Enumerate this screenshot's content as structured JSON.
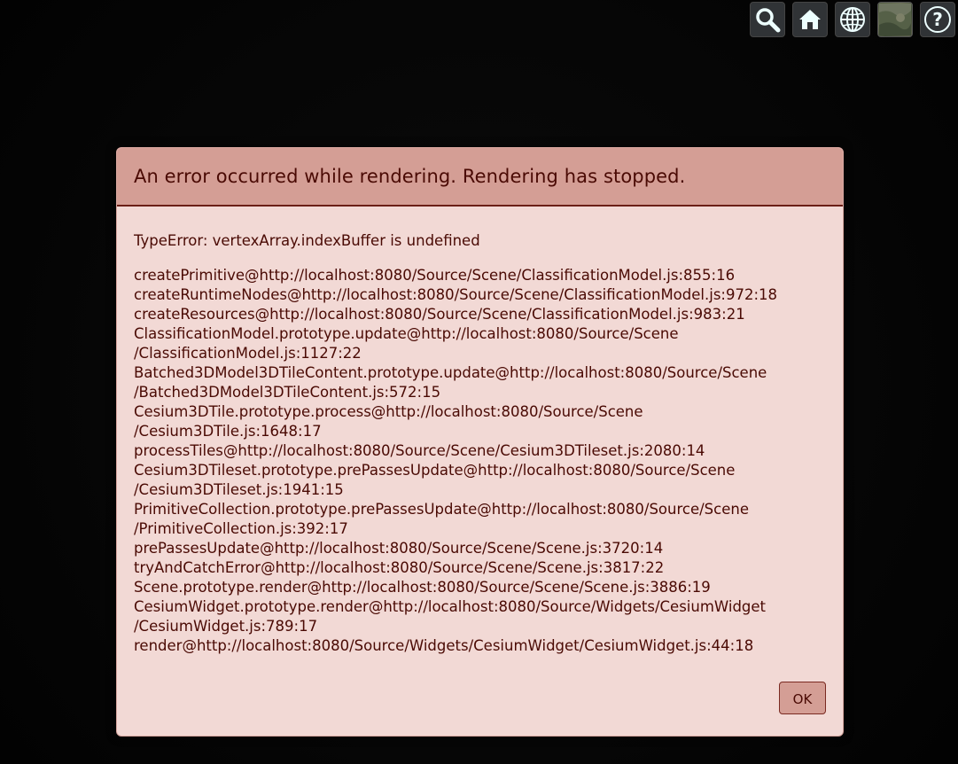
{
  "toolbar": {
    "buttons": [
      {
        "name": "search-icon"
      },
      {
        "name": "home-icon"
      },
      {
        "name": "globe-icon"
      },
      {
        "name": "imagery-layer-icon"
      },
      {
        "name": "help-icon",
        "glyph": "?"
      }
    ]
  },
  "error_dialog": {
    "title": "An error occurred while rendering. Rendering has stopped.",
    "message": "TypeError: vertexArray.indexBuffer is undefined",
    "stack": [
      "createPrimitive@http://localhost:8080/Source/Scene/ClassificationModel.js:855:16",
      "createRuntimeNodes@http://localhost:8080/Source/Scene/ClassificationModel.js:972:18",
      "createResources@http://localhost:8080/Source/Scene/ClassificationModel.js:983:21",
      "ClassificationModel.prototype.update@http://localhost:8080/Source/Scene",
      "/ClassificationModel.js:1127:22",
      "Batched3DModel3DTileContent.prototype.update@http://localhost:8080/Source/Scene",
      "/Batched3DModel3DTileContent.js:572:15",
      "Cesium3DTile.prototype.process@http://localhost:8080/Source/Scene",
      "/Cesium3DTile.js:1648:17",
      "processTiles@http://localhost:8080/Source/Scene/Cesium3DTileset.js:2080:14",
      "Cesium3DTileset.prototype.prePassesUpdate@http://localhost:8080/Source/Scene",
      "/Cesium3DTileset.js:1941:15",
      "PrimitiveCollection.prototype.prePassesUpdate@http://localhost:8080/Source/Scene",
      "/PrimitiveCollection.js:392:17",
      "prePassesUpdate@http://localhost:8080/Source/Scene/Scene.js:3720:14",
      "tryAndCatchError@http://localhost:8080/Source/Scene/Scene.js:3817:22",
      "Scene.prototype.render@http://localhost:8080/Source/Scene/Scene.js:3886:19",
      "CesiumWidget.prototype.render@http://localhost:8080/Source/Widgets/CesiumWidget",
      "/CesiumWidget.js:789:17",
      "render@http://localhost:8080/Source/Widgets/CesiumWidget/CesiumWidget.js:44:18"
    ],
    "ok_label": "OK"
  },
  "colors": {
    "header_bg": "#d49e95",
    "body_bg": "#f2d9d5",
    "text": "#4a0a04"
  }
}
